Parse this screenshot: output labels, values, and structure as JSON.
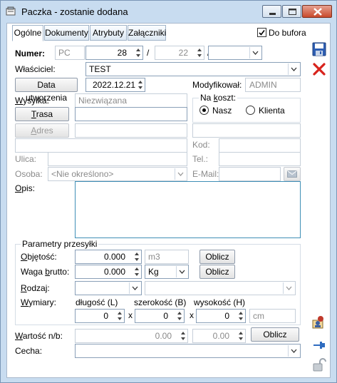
{
  "window": {
    "title": "Paczka - zostanie dodana"
  },
  "tabs": [
    "Ogólne",
    "Dokumenty",
    "Atrybuty",
    "Załączniki"
  ],
  "do_bufora": {
    "label": "Do bufora",
    "checked": true
  },
  "numer": {
    "label": "Numer:",
    "prefix": "PC",
    "number": "28",
    "sep1": "/",
    "year": "22",
    "sep2": "/",
    "series": ""
  },
  "wlasciciel": {
    "label": "Właściciel:",
    "value": "TEST"
  },
  "data": {
    "button": "Data utworzenia",
    "value": "2022.12.21"
  },
  "modyfikowal": {
    "label": "Modyfikował:",
    "value": "ADMIN"
  },
  "wysylka": {
    "label": "Wysyłka:",
    "value": "Niezwiązana"
  },
  "trasa": {
    "button": "Trasa",
    "value": ""
  },
  "na_koszt": {
    "label": "Na koszt:",
    "options": [
      "Nasz",
      "Klienta"
    ],
    "selected": "Nasz"
  },
  "adres": {
    "button": "Adres"
  },
  "kod": {
    "label": "Kod:"
  },
  "ulica": {
    "label": "Ulica:"
  },
  "tel": {
    "label": "Tel.:"
  },
  "osoba": {
    "label": "Osoba:",
    "value": "<Nie określono>"
  },
  "email": {
    "label": "E-Mail:"
  },
  "opis": {
    "label": "Opis:"
  },
  "parametry": {
    "title": "Parametry przesyłki",
    "objetosc": {
      "label": "Objętość:",
      "value": "0.000",
      "unit": "m3",
      "button": "Oblicz"
    },
    "waga": {
      "label": "Waga brutto:",
      "value": "0.000",
      "unit": "Kg",
      "button": "Oblicz"
    },
    "rodzaj": {
      "label": "Rodzaj:"
    },
    "wymiary": {
      "label": "Wymiary:",
      "dlugosc": "długość (L)",
      "szerokosc": "szerokość (B)",
      "wysokosc": "wysokość (H)",
      "l": "0",
      "b": "0",
      "h": "0",
      "x": "x",
      "unit": "cm"
    }
  },
  "wartosc": {
    "label": "Wartość n/b:",
    "value1": "0.00",
    "value2": "0.00",
    "button": "Oblicz"
  },
  "cecha": {
    "label": "Cecha:"
  },
  "icons": {
    "save": "save-icon",
    "delete": "delete-icon",
    "user": "user-card-icon",
    "pin": "pin-icon",
    "lock": "lock-icon"
  }
}
